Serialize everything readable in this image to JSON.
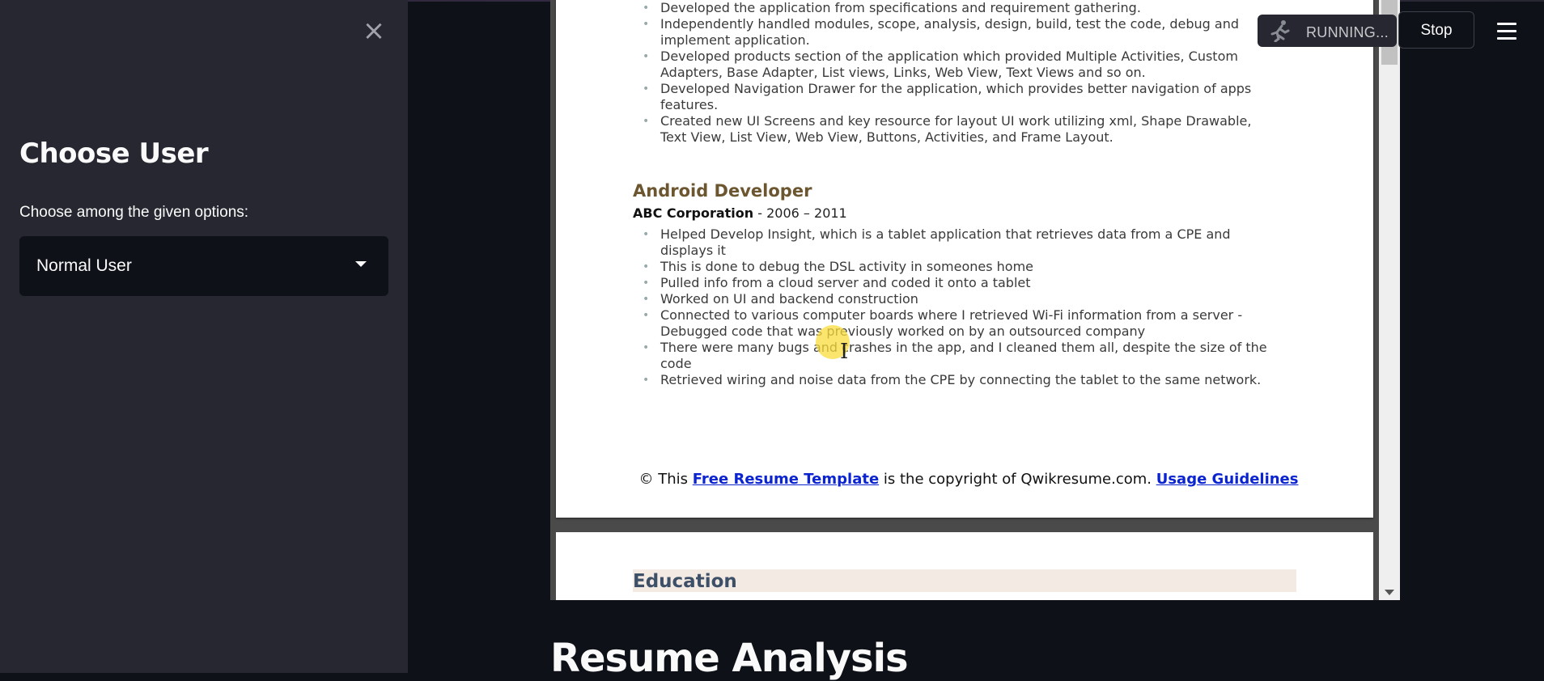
{
  "sidebar": {
    "close_label": "×",
    "title": "Choose User",
    "select_label": "Choose among the given options:",
    "select_value": "Normal User"
  },
  "status": {
    "running_text": "RUNNING...",
    "stop_label": "Stop",
    "icons": {
      "runner": "running-man-icon",
      "menu": "hamburger-menu-icon",
      "close": "close-icon",
      "caret": "chevron-down-icon"
    }
  },
  "resume": {
    "top_bullets": [
      "Developed the application from specifications and requirement gathering.",
      "Independently handled modules, scope, analysis, design, build, test the code, debug and implement application.",
      "Developed products section of the application which provided Multiple Activities, Custom Adapters, Base Adapter, List views, Links, Web View, Text Views and so on.",
      "Developed Navigation Drawer for the application, which provides better navigation of apps features.",
      "Created new UI Screens and key resource for layout UI work utilizing xml, Shape Drawable, Text View, List View, Web View, Buttons, Activities, and Frame Layout."
    ],
    "job_title": "Android Developer",
    "company_name": "ABC Corporation",
    "company_years": " - 2006 – 2011",
    "job_bullets": [
      "Helped Develop Insight, which is a tablet application that retrieves data from a CPE and displays it",
      "This is done to debug the DSL activity in someones home",
      "Pulled info from a cloud server and coded it onto a tablet",
      "Worked on UI and backend construction",
      "Connected to various computer boards where I retrieved Wi-Fi information from a server - Debugged code that was previously worked on by an outsourced company",
      "There were many bugs and crashes in the app, and I cleaned them all, despite the size of the code",
      "Retrieved wiring and noise data from the CPE by connecting the tablet to the same network."
    ],
    "copyright_prefix": "© This ",
    "copyright_link": "Free Resume Template",
    "copyright_middle": " is the copyright of Qwikresume.com. ",
    "copyright_link2": "Usage Guidelines",
    "education_title": "Education"
  },
  "main": {
    "section_title": "Resume Analysis"
  },
  "colors": {
    "app_bg": "#0e1117",
    "sidebar_bg": "#262730",
    "job_title": "#6b5630",
    "link": "#0b24cf",
    "education_title": "#3e4f68"
  }
}
